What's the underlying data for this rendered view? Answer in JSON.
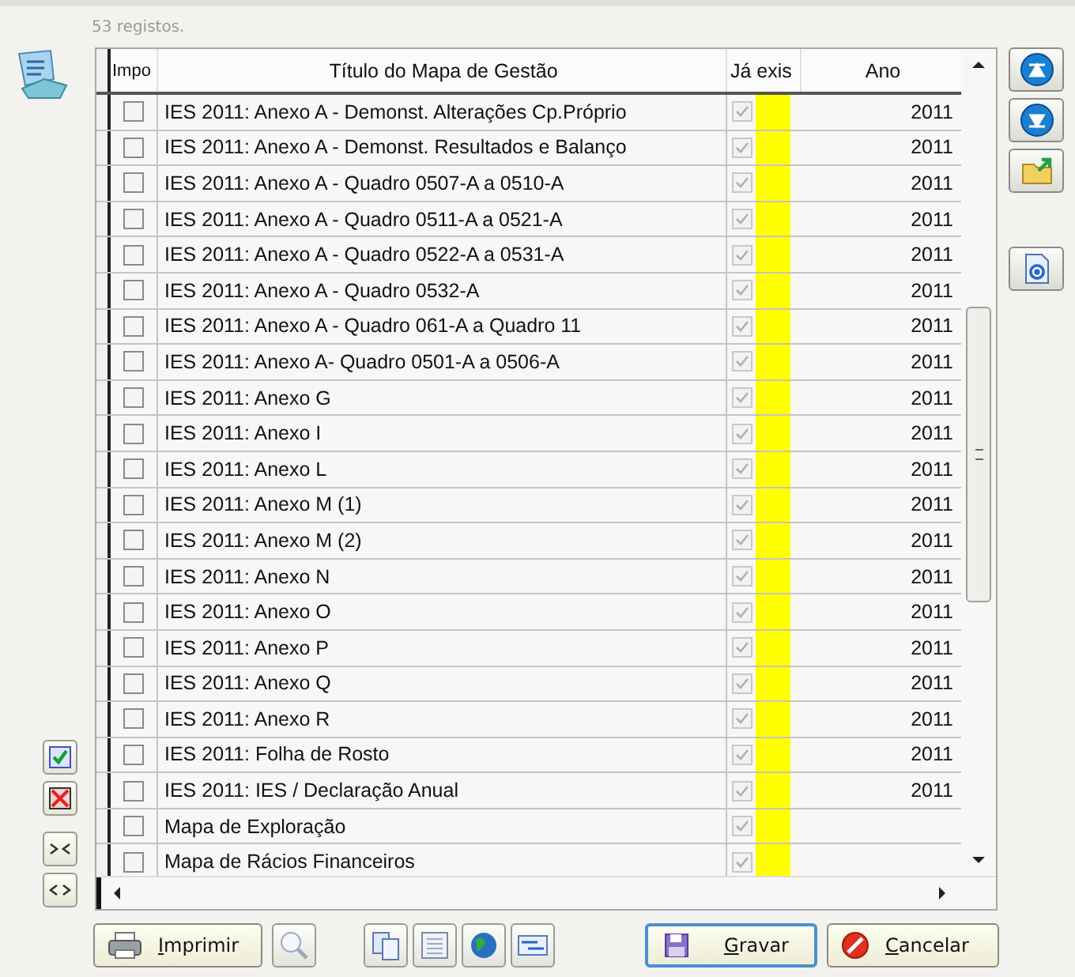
{
  "record_count": "53 registos.",
  "columns": [
    "Impo",
    "Título do Mapa de Gestão",
    "Já exis",
    "Ano"
  ],
  "rows": [
    {
      "import": false,
      "title": "IES 2011: Anexo A - Demonst. Alterações Cp.Próprio",
      "exists": true,
      "year": "2011"
    },
    {
      "import": false,
      "title": "IES 2011: Anexo A - Demonst. Resultados e Balanço",
      "exists": true,
      "year": "2011"
    },
    {
      "import": false,
      "title": "IES 2011: Anexo A - Quadro 0507-A a 0510-A",
      "exists": true,
      "year": "2011"
    },
    {
      "import": false,
      "title": "IES 2011: Anexo A - Quadro 0511-A a 0521-A",
      "exists": true,
      "year": "2011"
    },
    {
      "import": false,
      "title": "IES 2011: Anexo A - Quadro 0522-A a 0531-A",
      "exists": true,
      "year": "2011"
    },
    {
      "import": false,
      "title": "IES 2011: Anexo A - Quadro 0532-A",
      "exists": true,
      "year": "2011"
    },
    {
      "import": false,
      "title": "IES 2011: Anexo A - Quadro 061-A a Quadro 11",
      "exists": true,
      "year": "2011"
    },
    {
      "import": false,
      "title": "IES 2011: Anexo A- Quadro 0501-A a 0506-A",
      "exists": true,
      "year": "2011"
    },
    {
      "import": false,
      "title": "IES 2011: Anexo G",
      "exists": true,
      "year": "2011"
    },
    {
      "import": false,
      "title": "IES 2011: Anexo I",
      "exists": true,
      "year": "2011"
    },
    {
      "import": false,
      "title": "IES 2011: Anexo L",
      "exists": true,
      "year": "2011"
    },
    {
      "import": false,
      "title": "IES 2011: Anexo M (1)",
      "exists": true,
      "year": "2011"
    },
    {
      "import": false,
      "title": "IES 2011: Anexo M (2)",
      "exists": true,
      "year": "2011"
    },
    {
      "import": false,
      "title": "IES 2011: Anexo N",
      "exists": true,
      "year": "2011"
    },
    {
      "import": false,
      "title": "IES 2011: Anexo O",
      "exists": true,
      "year": "2011"
    },
    {
      "import": false,
      "title": "IES 2011: Anexo P",
      "exists": true,
      "year": "2011"
    },
    {
      "import": false,
      "title": "IES 2011: Anexo Q",
      "exists": true,
      "year": "2011"
    },
    {
      "import": false,
      "title": "IES 2011: Anexo R",
      "exists": true,
      "year": "2011"
    },
    {
      "import": false,
      "title": "IES 2011: Folha de Rosto",
      "exists": true,
      "year": "2011"
    },
    {
      "import": false,
      "title": "IES 2011: IES / Declaração Anual",
      "exists": true,
      "year": "2011"
    },
    {
      "import": false,
      "title": "Mapa de Exploração",
      "exists": true
    },
    {
      "import": false,
      "title": "Mapa de Rácios Financeiros",
      "exists": true
    }
  ],
  "buttons": {
    "print": "Imprimir",
    "save": "Gravar",
    "cancel": "Cancelar"
  }
}
